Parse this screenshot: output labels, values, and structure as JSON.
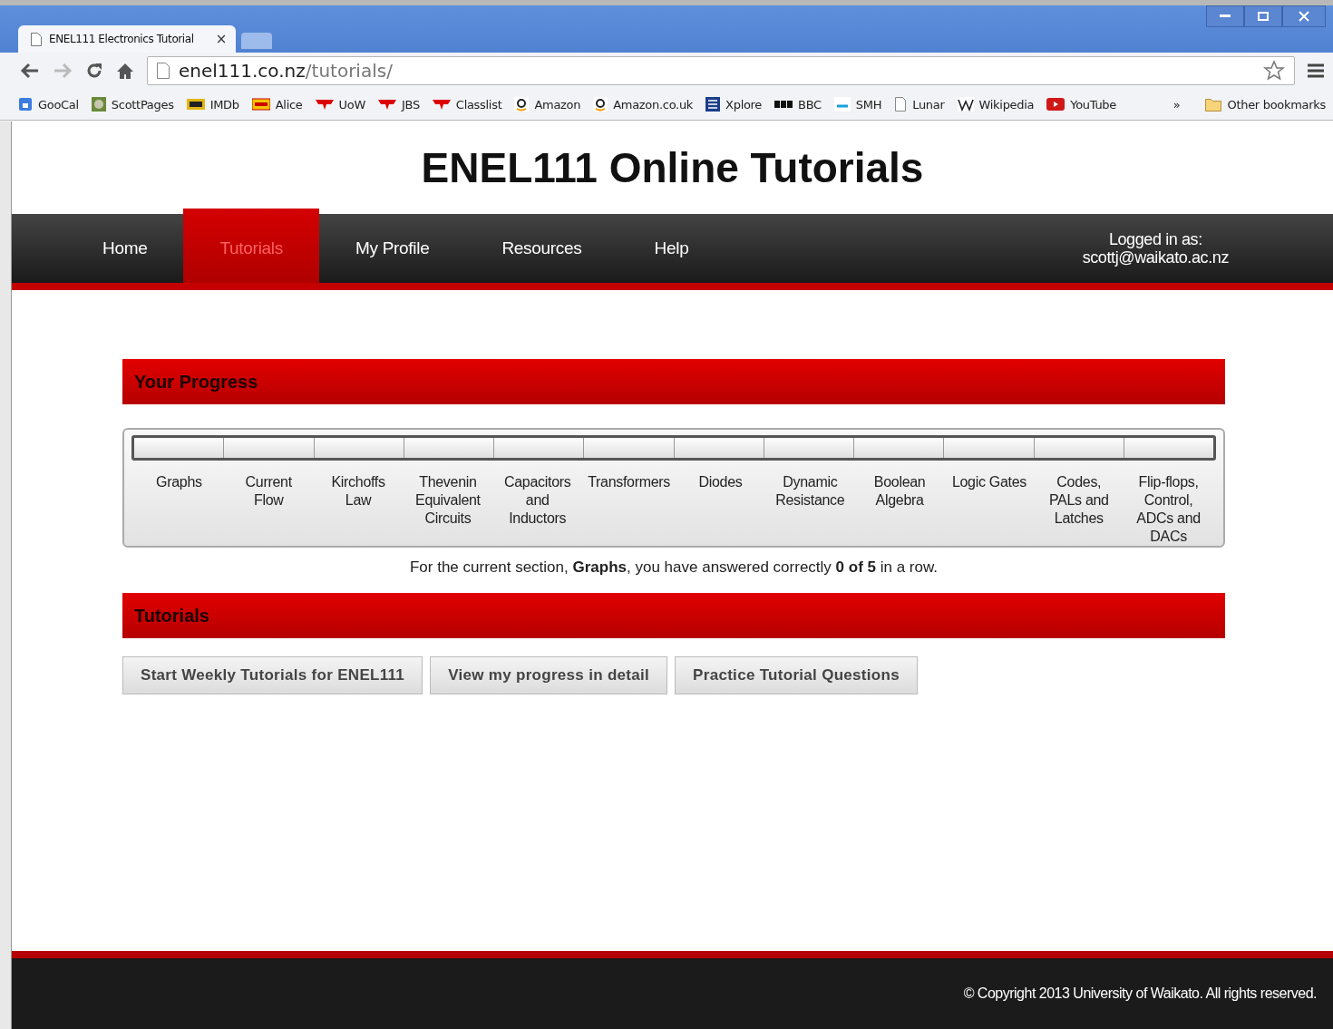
{
  "browser": {
    "tab_title": "ENEL111 Electronics Tutorial",
    "tab_close": "×",
    "url_host": "enel111.co.nz",
    "url_path": "/tutorials/",
    "bookmarks": [
      {
        "label": "GooCal"
      },
      {
        "label": "ScottPages"
      },
      {
        "label": "IMDb"
      },
      {
        "label": "Alice"
      },
      {
        "label": "UoW"
      },
      {
        "label": "JBS"
      },
      {
        "label": "Classlist"
      },
      {
        "label": "Amazon"
      },
      {
        "label": "Amazon.co.uk"
      },
      {
        "label": "Xplore"
      },
      {
        "label": "BBC"
      },
      {
        "label": "SMH"
      },
      {
        "label": "Lunar"
      },
      {
        "label": "Wikipedia"
      },
      {
        "label": "YouTube"
      }
    ],
    "overflow": "»",
    "other_bookmarks": "Other bookmarks"
  },
  "site_title": "ENEL111 Online Tutorials",
  "nav": {
    "items": [
      {
        "label": "Home",
        "selected": false
      },
      {
        "label": "Tutorials",
        "selected": true
      },
      {
        "label": "My Profile",
        "selected": false
      },
      {
        "label": "Resources",
        "selected": false
      },
      {
        "label": "Help",
        "selected": false
      }
    ],
    "login_label": "Logged in as:",
    "login_email": "scottj@waikato.ac.nz"
  },
  "progress": {
    "heading": "Your Progress",
    "sections": [
      {
        "label": "Graphs",
        "complete": false
      },
      {
        "label": "Current Flow",
        "complete": false
      },
      {
        "label": "Kirchoffs Law",
        "complete": false
      },
      {
        "label": "Thevenin Equivalent Circuits",
        "complete": false
      },
      {
        "label": "Capacitors and Inductors",
        "complete": false
      },
      {
        "label": "Transformers",
        "complete": false
      },
      {
        "label": "Diodes",
        "complete": false
      },
      {
        "label": "Dynamic Resistance",
        "complete": false
      },
      {
        "label": "Boolean Algebra",
        "complete": false
      },
      {
        "label": "Logic Gates",
        "complete": false
      },
      {
        "label": "Codes, PALs and Latches",
        "complete": false
      },
      {
        "label": "Flip-flops, Control, ADCs and DACs",
        "complete": false
      }
    ],
    "status": "For the current section, **Graphs**, you have answered correctly **0 of 5** in a row."
  },
  "tutorials": {
    "heading": "Tutorials",
    "buttons": [
      "Start Weekly Tutorials for ENEL111",
      "View my progress in detail",
      "Practice Tutorial Questions"
    ]
  },
  "footer": "© Copyright 2013 University of Waikato. All rights reserved."
}
